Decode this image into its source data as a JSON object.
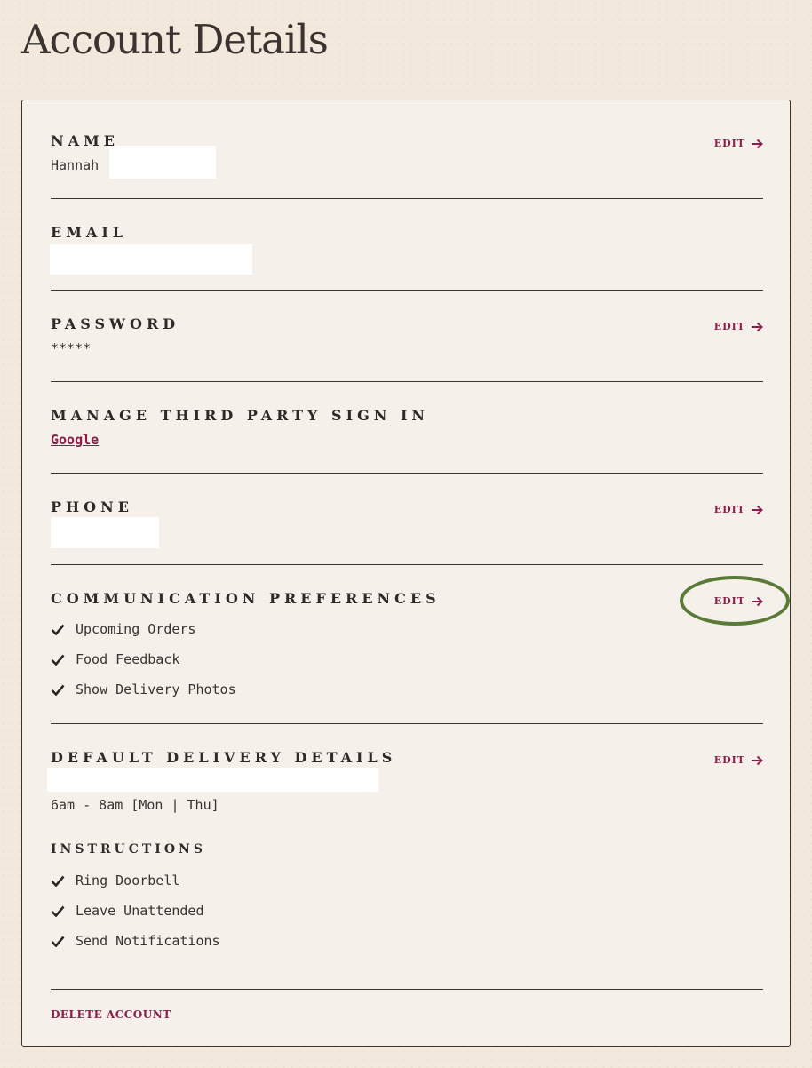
{
  "page": {
    "title": "Account Details"
  },
  "sections": {
    "name": {
      "label": "NAME",
      "value": "Hannah",
      "edit": "EDIT"
    },
    "email": {
      "label": "EMAIL"
    },
    "password": {
      "label": "PASSWORD",
      "value": "*****",
      "edit": "EDIT"
    },
    "third_party": {
      "label": "MANAGE THIRD PARTY SIGN IN",
      "link": "Google"
    },
    "phone": {
      "label": "PHONE",
      "edit": "EDIT"
    },
    "communication": {
      "label": "COMMUNICATION PREFERENCES",
      "edit": "EDIT",
      "items": [
        "Upcoming Orders",
        "Food Feedback",
        "Show Delivery Photos"
      ]
    },
    "delivery": {
      "label": "DEFAULT DELIVERY DETAILS",
      "edit": "EDIT",
      "window": "6am - 8am [Mon | Thu]",
      "instructions_label": "INSTRUCTIONS",
      "instructions": [
        "Ring Doorbell",
        "Leave Unattended",
        "Send Notifications"
      ]
    }
  },
  "footer": {
    "delete_label": "DELETE ACCOUNT"
  },
  "icons": {
    "edit": "arrow-right-icon",
    "check": "check-icon"
  },
  "colors": {
    "accent": "#8a1f4a",
    "highlight_circle": "#5a7a38",
    "background": "#f2e9dc"
  }
}
